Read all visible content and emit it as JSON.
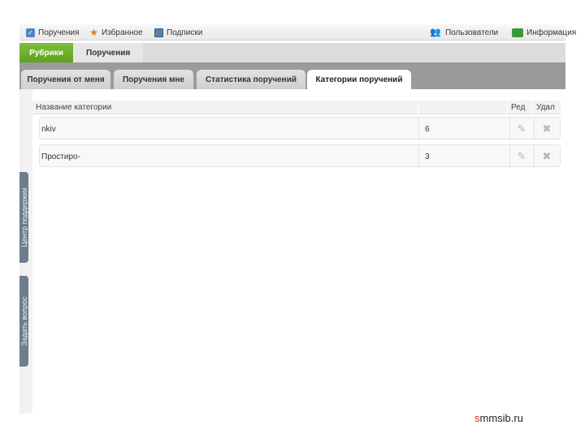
{
  "toolbar": {
    "items": [
      {
        "label": "Поручения",
        "icon": "check-icon"
      },
      {
        "label": "Избранное",
        "icon": "star-icon"
      },
      {
        "label": "Подписки",
        "icon": "image-icon"
      },
      {
        "label": "Пользователи",
        "icon": "users-icon"
      },
      {
        "label": "Информация",
        "icon": "info-icon"
      }
    ]
  },
  "nav": {
    "active": "Рубрики",
    "item": "Поручения"
  },
  "tabs": [
    {
      "label": "Поручения от меня"
    },
    {
      "label": "Поручения мне"
    },
    {
      "label": "Статистика поручений"
    },
    {
      "label": "Категории поручений",
      "active": true
    }
  ],
  "table": {
    "columns": [
      "Название категории",
      "",
      "Ред",
      "Удал"
    ],
    "rows": [
      {
        "name": "nkiv",
        "count": "6"
      },
      {
        "name": "Простиро-",
        "count": "3"
      }
    ]
  },
  "side_tabs": [
    "Центр поддержки",
    "Задать вопрос"
  ],
  "footer": {
    "brand_s": "s",
    "brand_rest": "mmsib.ru"
  },
  "colors": {
    "accent_green": "#6cb12c",
    "tabs_bar": "#9b9b9b",
    "side_tab": "#6f7d8f"
  }
}
